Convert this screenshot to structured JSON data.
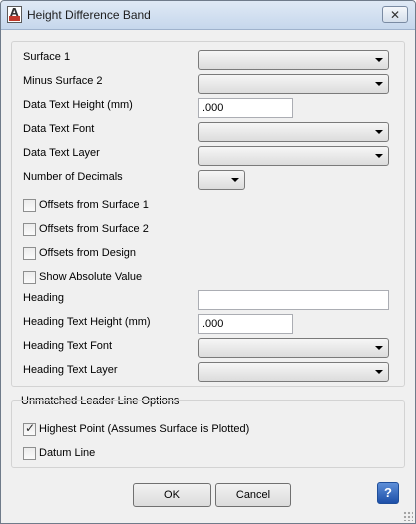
{
  "window": {
    "title": "Height Difference Band",
    "close_glyph": "✕"
  },
  "fields": {
    "surface1": {
      "label": "Surface 1",
      "value": ""
    },
    "minus_surface2": {
      "label": "Minus Surface 2",
      "value": ""
    },
    "data_text_height": {
      "label": "Data Text Height (mm)",
      "value": ".000"
    },
    "data_text_font": {
      "label": "Data Text Font",
      "value": ""
    },
    "data_text_layer": {
      "label": "Data Text Layer",
      "value": ""
    },
    "number_of_decimals": {
      "label": "Number of Decimals",
      "value": ""
    }
  },
  "checkboxes": {
    "offsets_surface1": {
      "label": "Offsets from Surface 1",
      "checked": false
    },
    "offsets_surface2": {
      "label": "Offsets from Surface 2",
      "checked": false
    },
    "offsets_design": {
      "label": "Offsets from Design",
      "checked": false
    },
    "show_absolute": {
      "label": "Show Absolute Value",
      "checked": false
    }
  },
  "heading": {
    "heading": {
      "label": "Heading",
      "value": ""
    },
    "text_height": {
      "label": "Heading Text Height (mm)",
      "value": ".000"
    },
    "text_font": {
      "label": "Heading Text Font",
      "value": ""
    },
    "text_layer": {
      "label": "Heading Text Layer",
      "value": ""
    }
  },
  "leader_group": {
    "title": "Unmatched Leader Line Options",
    "highest_point": {
      "label": "Highest Point (Assumes Surface is Plotted)",
      "checked": true
    },
    "datum_line": {
      "label": "Datum Line",
      "checked": false
    }
  },
  "buttons": {
    "ok": "OK",
    "cancel": "Cancel",
    "help": "?"
  },
  "icons": {
    "check_glyph": "✓",
    "app_letter": "A"
  }
}
